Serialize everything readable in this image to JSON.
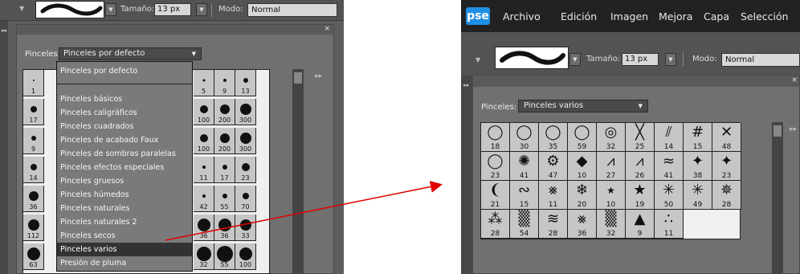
{
  "left": {
    "options": {
      "size_label": "Tamaño:",
      "size_value": "13 px",
      "mode_label": "Modo:",
      "mode_value": "Normal"
    },
    "panel": {
      "close": "×",
      "brushes_label": "Pinceles:",
      "brushes_selected": "Pinceles por defecto",
      "scroll_arrows": "▸▸"
    },
    "dropdown_items": [
      "Pinceles por defecto",
      "Pinceles básicos",
      "Pinceles caligráficos",
      "Pinceles cuadrados",
      "Pinceles de acabado Faux",
      "Pinceles de sombras paralelas",
      "Pinceles efectos especiales",
      "Pinceles gruesos",
      "Pinceles húmedos",
      "Pinceles naturales",
      "Pinceles naturales 2",
      "Pinceles secos",
      "Pinceles varios",
      "Presión de pluma"
    ],
    "dropdown_selected_index": 12,
    "grid_col1_numbers": [
      "1",
      "17",
      "9",
      "14",
      "36",
      "112",
      "63"
    ],
    "grid_right_numbers": [
      [
        "5",
        "9",
        "13"
      ],
      [
        "100",
        "200",
        "300"
      ],
      [
        "100",
        "200",
        "300"
      ],
      [
        "11",
        "17",
        "23"
      ],
      [
        "42",
        "55",
        "70"
      ],
      [
        "36",
        "36",
        "33"
      ],
      [
        "32",
        "55",
        "100"
      ]
    ]
  },
  "right": {
    "menu": [
      "Archivo",
      "Edición",
      "Imagen",
      "Mejora",
      "Capa",
      "Selección"
    ],
    "logo": "pse",
    "options": {
      "size_label": "Tamaño:",
      "size_value": "13 px",
      "mode_label": "Modo:",
      "mode_value": "Normal"
    },
    "panel": {
      "close": "×",
      "brushes_label": "Pinceles:",
      "brushes_selected": "Pinceles varios",
      "scroll_arrows": "▸▸"
    },
    "grid_rows": [
      [
        "18",
        "30",
        "35",
        "59",
        "32",
        "25",
        "14",
        "15",
        "48"
      ],
      [
        "23",
        "41",
        "47",
        "10",
        "27",
        "26",
        "41",
        "38",
        "23"
      ],
      [
        "21",
        "15",
        "11",
        "20",
        "10",
        "19",
        "50",
        "49",
        "28"
      ],
      [
        "28",
        "54",
        "28",
        "36",
        "32",
        "9",
        "11"
      ]
    ],
    "grid_icons": [
      [
        "circle-outline-icon",
        "circle-outline-icon",
        "circle-outline-icon",
        "circle-outline-icon",
        "double-circle-icon",
        "thin-x-icon",
        "hatch-icon",
        "hash-icon",
        "large-x-icon"
      ],
      [
        "circle-outline-icon",
        "starburst-icon",
        "dashed-circle-icon",
        "diamond-icon",
        "zigzag-icon",
        "zigzag-icon",
        "streak-icon",
        "splash-icon",
        "splash-icon"
      ],
      [
        "drop-icon",
        "squiggle-icon",
        "scribble-icon",
        "snowflake-icon",
        "small-star-icon",
        "star-icon",
        "sparkle-icon",
        "sparkle-icon",
        "burst-icon"
      ],
      [
        "grass-icon",
        "texture-icon",
        "lines-icon",
        "scribble-icon",
        "texture-icon",
        "triangle-icon",
        "dots-icon"
      ]
    ]
  }
}
